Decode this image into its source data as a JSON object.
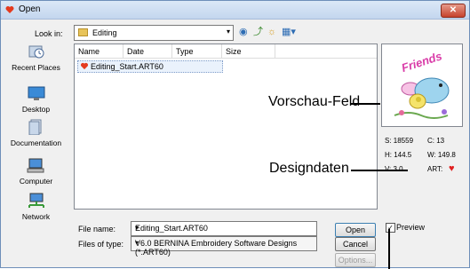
{
  "window": {
    "title": "Open",
    "close_symbol": "✕"
  },
  "lookin": {
    "label": "Look in:",
    "value": "Editing"
  },
  "toolbar": {
    "back": "◉",
    "up": "⤴",
    "new_folder": "☼",
    "views": "▦▾"
  },
  "places": [
    {
      "label": "Recent Places",
      "icon": "recent-places-icon"
    },
    {
      "label": "Desktop",
      "icon": "desktop-icon"
    },
    {
      "label": "Documentation",
      "icon": "documentation-icon"
    },
    {
      "label": "Computer",
      "icon": "computer-icon"
    },
    {
      "label": "Network",
      "icon": "network-icon"
    }
  ],
  "columns": [
    "Name",
    "Date modif...",
    "Type",
    "Size"
  ],
  "files": [
    {
      "name": "Editing_Start.ART60"
    }
  ],
  "preview_image_text": "Friends",
  "design_info": {
    "s": "S: 18559",
    "c": "C: 13",
    "h": "H: 144.5",
    "w": "W: 149.8",
    "v": "V: 3.0",
    "art": "ART:",
    "art_symbol": "♥"
  },
  "filename": {
    "label": "File name:",
    "value": "Editing_Start.ART60"
  },
  "filetype": {
    "label": "Files of type:",
    "value": "V6.0 BERNINA Embroidery Software Designs (*.ART60)"
  },
  "buttons": {
    "open": "Open",
    "cancel": "Cancel",
    "options": "Options..."
  },
  "preview_checkbox": {
    "label": "Preview",
    "checked_symbol": "✓"
  },
  "callouts": {
    "preview_field": "Vorschau-Feld",
    "design_data": "Designdaten"
  }
}
